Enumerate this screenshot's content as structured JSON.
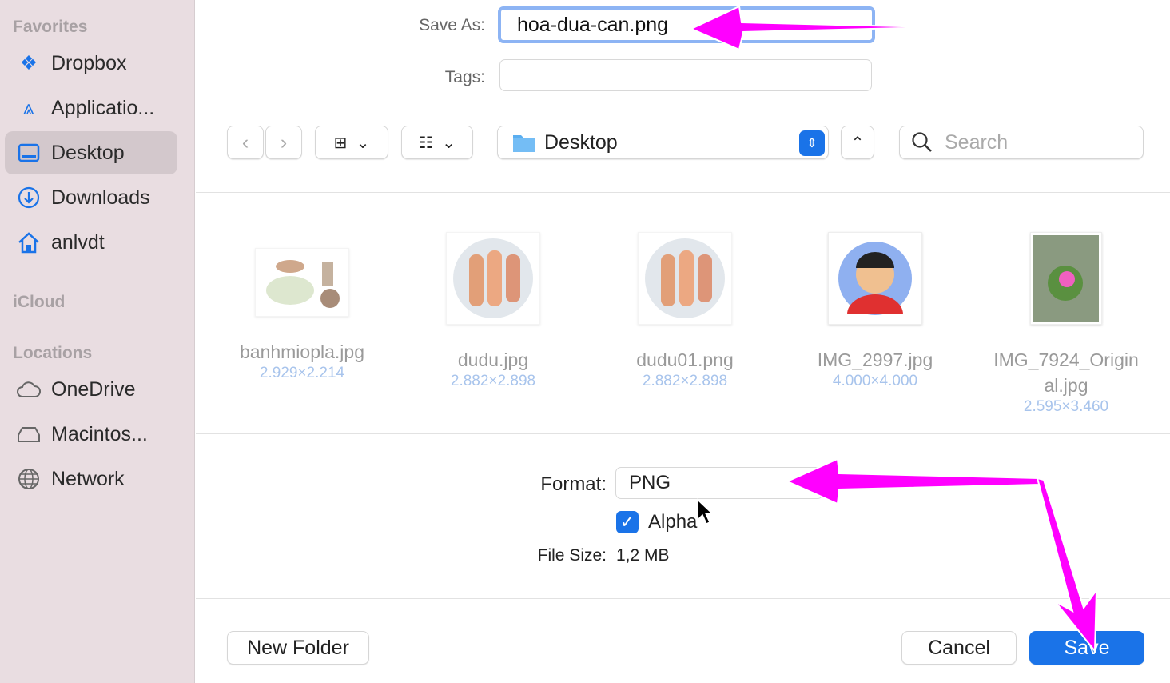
{
  "sidebar": {
    "favorites_label": "Favorites",
    "favorites": [
      {
        "label": "Dropbox",
        "icon": "dropbox-icon"
      },
      {
        "label": "Applicatio...",
        "icon": "applications-icon"
      },
      {
        "label": "Desktop",
        "icon": "desktop-icon",
        "selected": true
      },
      {
        "label": "Downloads",
        "icon": "downloads-icon"
      },
      {
        "label": "anlvdt",
        "icon": "home-icon"
      }
    ],
    "icloud_label": "iCloud",
    "locations_label": "Locations",
    "locations": [
      {
        "label": "OneDrive",
        "icon": "cloud-icon"
      },
      {
        "label": "Macintos...",
        "icon": "disk-icon"
      },
      {
        "label": "Network",
        "icon": "globe-icon"
      }
    ]
  },
  "save_as": {
    "label": "Save As:",
    "value": "hoa-dua-can.png"
  },
  "tags": {
    "label": "Tags:",
    "value": ""
  },
  "toolbar": {
    "location": "Desktop",
    "search_placeholder": "Search"
  },
  "files": [
    {
      "name": "banhmiopla.jpg",
      "dims": "2.929×2.214"
    },
    {
      "name": "dudu.jpg",
      "dims": "2.882×2.898"
    },
    {
      "name": "dudu01.png",
      "dims": "2.882×2.898"
    },
    {
      "name": "IMG_2997.jpg",
      "dims": "4.000×4.000"
    },
    {
      "name": "IMG_7924_Origin al.jpg",
      "dims": "2.595×3.460"
    }
  ],
  "format": {
    "label": "Format:",
    "value": "PNG",
    "alpha_label": "Alpha",
    "alpha_checked": true,
    "filesize_label": "File Size:",
    "filesize": "1,2 MB"
  },
  "buttons": {
    "new_folder": "New Folder",
    "cancel": "Cancel",
    "save": "Save"
  },
  "colors": {
    "accent": "#1a73e8",
    "annotation": "#ff00ff"
  }
}
